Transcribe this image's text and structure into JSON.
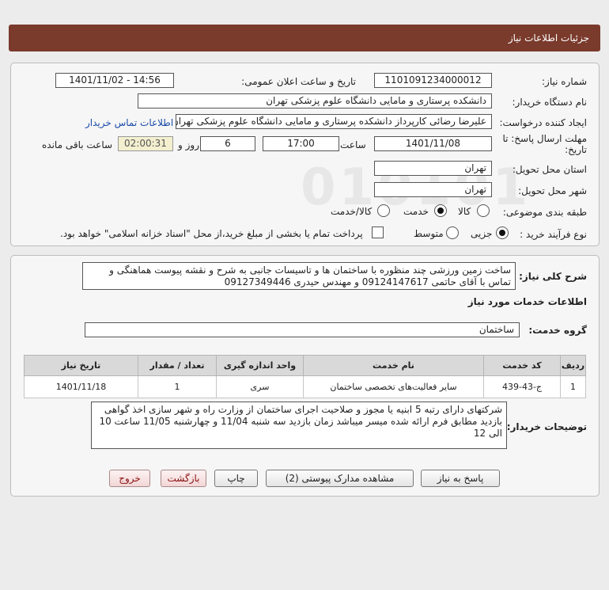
{
  "header": {
    "title": "جزئیات اطلاعات نیاز"
  },
  "info": {
    "need_number_label": "شماره نیاز:",
    "need_number": "1101091234000012",
    "announce_label": "تاریخ و ساعت اعلان عمومی:",
    "announce_value": "1401/11/02 - 14:56",
    "buyer_org_label": "نام دستگاه خریدار:",
    "buyer_org": "دانشکده پرستاری و مامایی دانشگاه علوم پزشکی تهران",
    "creator_label": "ایجاد کننده درخواست:",
    "creator": "علیرضا رضائی کارپرداز دانشکده پرستاری و مامایی دانشگاه علوم پزشکی تهران",
    "contact_link": "اطلاعات تماس خریدار",
    "deadline_label_1": "مهلت ارسال پاسخ: تا",
    "deadline_label_2": "تاریخ:",
    "deadline_date": "1401/11/08",
    "time_label": "ساعت",
    "deadline_time": "17:00",
    "days_value": "6",
    "days_label": "روز و",
    "remaining_time": "02:00:31",
    "remaining_label": "ساعت باقی مانده",
    "province_label": "استان محل تحویل:",
    "province": "تهران",
    "city_label": "شهر محل تحویل:",
    "city": "تهران",
    "category_label": "طبقه بندی موضوعی:",
    "category_options": [
      "کالا",
      "خدمت",
      "کالا/خدمت"
    ],
    "category_selected": "خدمت",
    "process_label": "نوع فرآیند خرید :",
    "process_options": [
      "جزیی",
      "متوسط"
    ],
    "process_selected": "جزیی",
    "payment_note": "پرداخت تمام یا بخشی از مبلغ خرید،از محل \"اسناد خزانه اسلامی\" خواهد بود."
  },
  "details": {
    "summary_label": "شرح کلی نیاز:",
    "summary_text": "ساخت زمین ورزشی چند منظوره با ساختمان ها و تاسیسات جانبی به شرح و نقشه پیوست هماهنگی و تماس با آقای حاتمی 09124147617 و مهندس حیدری 09127349446",
    "services_heading": "اطلاعات خدمات مورد نیاز",
    "service_group_label": "گروه خدمت:",
    "service_group": "ساختمان",
    "table": {
      "headers": [
        "ردیف",
        "کد خدمت",
        "نام خدمت",
        "واحد اندازه گیری",
        "تعداد / مقدار",
        "تاریخ نیاز"
      ],
      "rows": [
        [
          "1",
          "ج-43-439",
          "سایر فعالیت‌های تخصصی ساختمان",
          "سری",
          "1",
          "1401/11/18"
        ]
      ]
    },
    "buyer_notes_label": "توضیحات خریدار:",
    "buyer_notes": "شرکتهای دارای رتبه 5 ابنیه یا مجوز و صلاحیت اجرای ساختمان از وزارت راه و شهر سازی اخذ گواهی بازدید مطابق فرم ارائه شده میسر میباشد زمان بازدید سه شنبه 11/04 و چهارشنبه 11/05 ساعت 10 الی 12"
  },
  "buttons": {
    "reply": "پاسخ به نیاز",
    "attachments": "مشاهده مدارک پیوستی (2)",
    "print": "چاپ",
    "back": "بازگشت",
    "exit": "خروج"
  }
}
